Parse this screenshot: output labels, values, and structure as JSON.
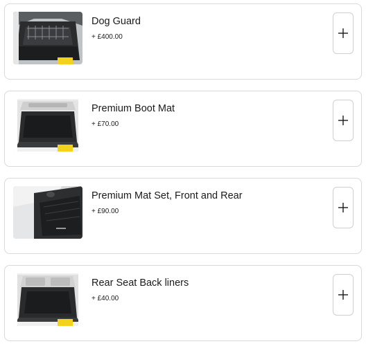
{
  "accessories": [
    {
      "name": "Dog Guard",
      "price": "+ £400.00",
      "image": "car-boot-dog-guard"
    },
    {
      "name": "Premium Boot Mat",
      "price": "+ £70.00",
      "image": "car-boot-mat"
    },
    {
      "name": "Premium Mat Set, Front and Rear",
      "price": "+ £90.00",
      "image": "car-floor-mats"
    },
    {
      "name": "Rear Seat Back liners",
      "price": "+ £40.00",
      "image": "car-boot-liner"
    }
  ],
  "add_icon": "plus-icon",
  "colors": {
    "border": "#d9d9d9",
    "text": "#1a1a1a",
    "yellow_plate": "#f2d21b"
  }
}
